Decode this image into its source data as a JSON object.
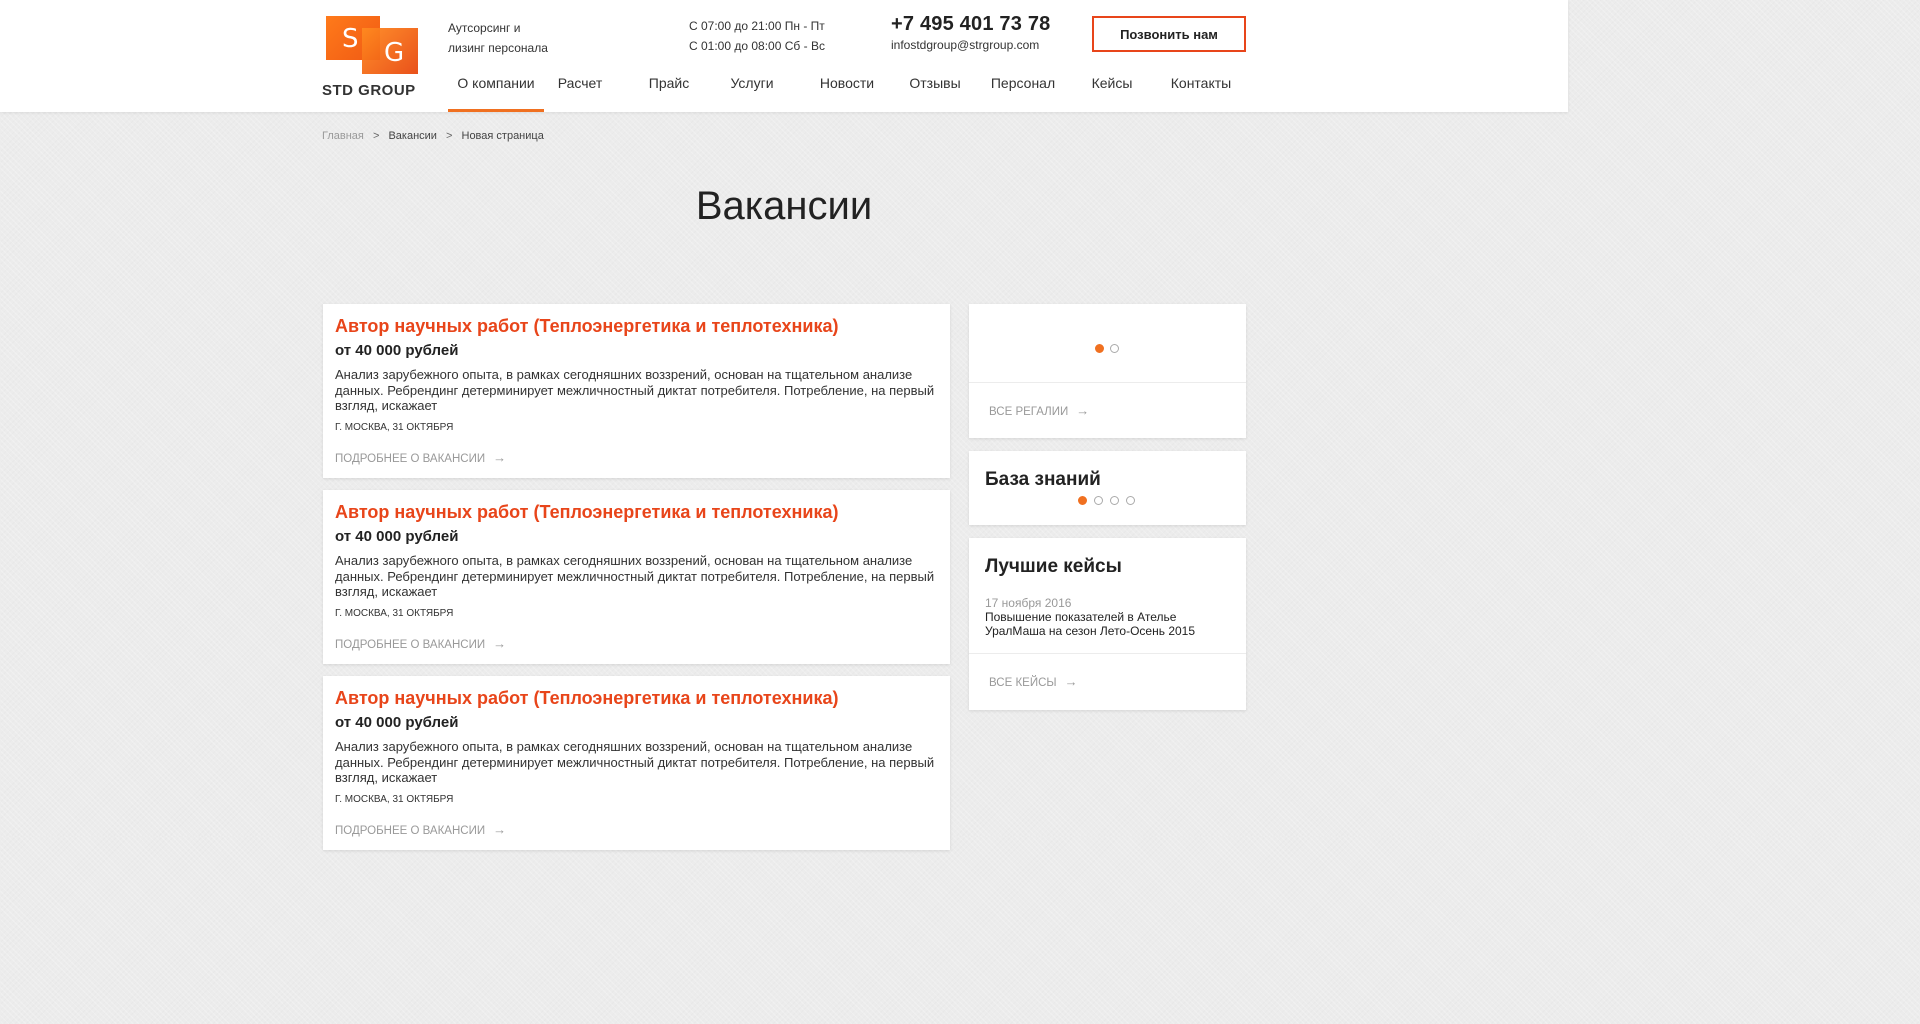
{
  "header": {
    "logo_letters": [
      "S",
      "G"
    ],
    "logo_text": "STD GROUP",
    "tagline_line1": "Аутсорсинг и",
    "tagline_line2": "лизинг персонала",
    "hours_line1": "С 07:00 до 21:00 Пн - Пт",
    "hours_line2": "С 01:00 до 08:00 Сб - Вс",
    "phone": "+7 495 401 73 78",
    "email": "infostdgroup@strgroup.com",
    "call_button": "Позвонить нам",
    "accent_color": "#f07020"
  },
  "nav": [
    {
      "label": "О компании",
      "active": true
    },
    {
      "label": "Расчет",
      "active": false
    },
    {
      "label": "Прайс",
      "active": false
    },
    {
      "label": "Услуги",
      "active": false
    },
    {
      "label": "Новости",
      "active": false
    },
    {
      "label": "Отзывы",
      "active": false
    },
    {
      "label": "Персонал",
      "active": false
    },
    {
      "label": "Кейсы",
      "active": false
    },
    {
      "label": "Контакты",
      "active": false
    }
  ],
  "breadcrumb": {
    "home": "Главная",
    "sep": ">",
    "section": "Вакансии",
    "current": "Новая страница"
  },
  "page_title": "Вакансии",
  "vacancies": [
    {
      "title": "Автор научных работ (Теплоэнергетика и теплотехника)",
      "salary": "от 40 000 рублей",
      "description": "Анализ зарубежного опыта, в рамках сегодняшних воззрений, основан на тщательном анализе данных. Ребрендинг детерминирует межличностный диктат потребителя. Потребление, на первый взгляд, искажает",
      "meta": "г. Москва, 31 октября",
      "link": "Подробнее о вакансии"
    },
    {
      "title": "Автор научных работ (Теплоэнергетика и теплотехника)",
      "salary": "от 40 000 рублей",
      "description": "Анализ зарубежного опыта, в рамках сегодняшних воззрений, основан на тщательном анализе данных. Ребрендинг детерминирует межличностный диктат потребителя. Потребление, на первый взгляд, искажает",
      "meta": "г. Москва, 31 октября",
      "link": "Подробнее о вакансии"
    },
    {
      "title": "Автор научных работ (Теплоэнергетика и теплотехника)",
      "salary": "от 40 000 рублей",
      "description": "Анализ зарубежного опыта, в рамках сегодняшних воззрений, основан на тщательном анализе данных. Ребрендинг детерминирует межличностный диктат потребителя. Потребление, на первый взгляд, искажает",
      "meta": "г. Москва, 31 октября",
      "link": "Подробнее о вакансии"
    }
  ],
  "sidebar": {
    "regalia": {
      "dots": 2,
      "active_dot": 0,
      "link": "Все регалии"
    },
    "knowledge": {
      "title": "База знаний",
      "dots": 4,
      "active_dot": 0
    },
    "cases": {
      "title": "Лучшие кейсы",
      "date": "17 ноября 2016",
      "text": "Повышение показателей в Ателье УралМаша на сезон Лето-Осень 2015",
      "link": "Все кейсы"
    }
  },
  "icons": {
    "arrow": "→"
  }
}
